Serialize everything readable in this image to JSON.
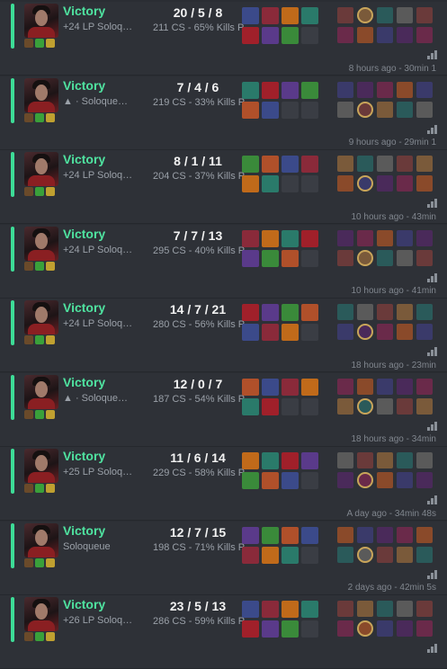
{
  "matches": [
    {
      "result": "Victory",
      "sub": "+24 LP Soloq…",
      "kda": "20 / 5 / 8",
      "cs": "211 CS - 65% Kills P.",
      "time": ""
    },
    {
      "result": "Victory",
      "sub": "▲ · Soloque…",
      "kda": "7 / 4 / 6",
      "cs": "219 CS - 33% Kills P.",
      "time": "8 hours ago - 30min 1"
    },
    {
      "result": "Victory",
      "sub": "+24 LP Soloq…",
      "kda": "8 / 1 / 11",
      "cs": "204 CS - 37% Kills P.",
      "time": "9 hours ago - 29min 1"
    },
    {
      "result": "Victory",
      "sub": "+24 LP Soloq…",
      "kda": "7 / 7 / 13",
      "cs": "295 CS - 40% Kills P.",
      "time": "10 hours ago - 43min"
    },
    {
      "result": "Victory",
      "sub": "+24 LP Soloq…",
      "kda": "14 / 7 / 21",
      "cs": "280 CS - 56% Kills P.",
      "time": "10 hours ago - 41min"
    },
    {
      "result": "Victory",
      "sub": "▲ · Soloque…",
      "kda": "12 / 0 / 7",
      "cs": "187 CS - 54% Kills P.",
      "time": "18 hours ago - 23min"
    },
    {
      "result": "Victory",
      "sub": "+25 LP Soloq…",
      "kda": "11 / 6 / 14",
      "cs": "229 CS - 58% Kills P.",
      "time": "18 hours ago - 34min"
    },
    {
      "result": "Victory",
      "sub": "Soloqueue",
      "kda": "12 / 7 / 15",
      "cs": "198 CS - 71% Kills P.",
      "time": "A day ago - 34min 48s"
    },
    {
      "result": "Victory",
      "sub": "+26 LP Soloq…",
      "kda": "23 / 5 / 13",
      "cs": "286 CS - 59% Kills P.",
      "time": "2 days ago - 42min 5s"
    }
  ],
  "colors": {
    "victory": "#4fe3a0",
    "accent_bar": "#3ddc97",
    "item_palette": [
      "#3b4a8a",
      "#8a2a3a",
      "#c06a1a",
      "#2a7a6a",
      "#a0202a",
      "#5a3a8a",
      "#3a8a3a",
      "#b0502a"
    ],
    "player_palette": [
      "#6a3a3a",
      "#3a3a6a",
      "#7a5a3a",
      "#4a2a5a",
      "#2a5a5a",
      "#6a2a4a",
      "#5a5a5a",
      "#8a4a2a"
    ]
  }
}
